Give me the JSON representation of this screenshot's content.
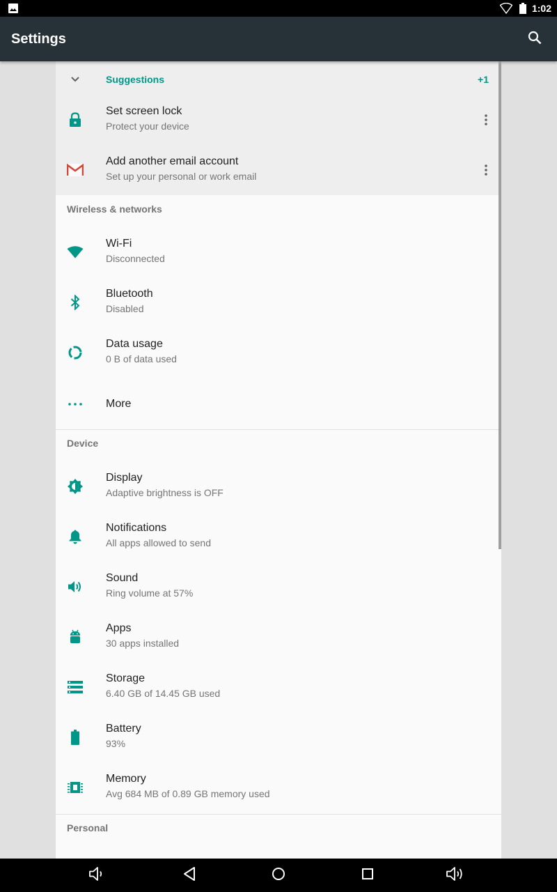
{
  "status_bar": {
    "time": "1:02",
    "icons": [
      "image-notification-icon",
      "wifi-icon",
      "battery-icon"
    ]
  },
  "app_bar": {
    "title": "Settings",
    "search_icon": "search-icon"
  },
  "suggestions": {
    "label": "Suggestions",
    "count": "+1",
    "items": [
      {
        "title": "Set screen lock",
        "summary": "Protect your device",
        "icon": "lock-icon"
      },
      {
        "title": "Add another email account",
        "summary": "Set up your personal or work email",
        "icon": "gmail-icon"
      }
    ]
  },
  "sections": {
    "wireless": {
      "header": "Wireless & networks",
      "items": [
        {
          "title": "Wi-Fi",
          "summary": "Disconnected",
          "icon": "wifi-icon"
        },
        {
          "title": "Bluetooth",
          "summary": "Disabled",
          "icon": "bluetooth-icon"
        },
        {
          "title": "Data usage",
          "summary": "0 B of data used",
          "icon": "data-usage-icon"
        },
        {
          "title": "More",
          "icon": "more-horiz-icon"
        }
      ]
    },
    "device": {
      "header": "Device",
      "items": [
        {
          "title": "Display",
          "summary": "Adaptive brightness is OFF",
          "icon": "brightness-icon"
        },
        {
          "title": "Notifications",
          "summary": "All apps allowed to send",
          "icon": "bell-icon"
        },
        {
          "title": "Sound",
          "summary": "Ring volume at 57%",
          "icon": "volume-icon"
        },
        {
          "title": "Apps",
          "summary": "30 apps installed",
          "icon": "android-icon"
        },
        {
          "title": "Storage",
          "summary": "6.40 GB of 14.45 GB used",
          "icon": "storage-icon"
        },
        {
          "title": "Battery",
          "summary": "93%",
          "icon": "battery-icon"
        },
        {
          "title": "Memory",
          "summary": "Avg 684 MB of 0.89 GB memory used",
          "icon": "memory-icon"
        }
      ]
    },
    "personal": {
      "header": "Personal"
    }
  },
  "nav_bar": {
    "buttons": [
      "volume-down-icon",
      "back-icon",
      "home-icon",
      "recents-icon",
      "volume-up-icon"
    ]
  },
  "colors": {
    "accent": "#009688",
    "app_bar": "#263238",
    "icon_tint": "#009688",
    "gmail_red": "#d44638"
  }
}
